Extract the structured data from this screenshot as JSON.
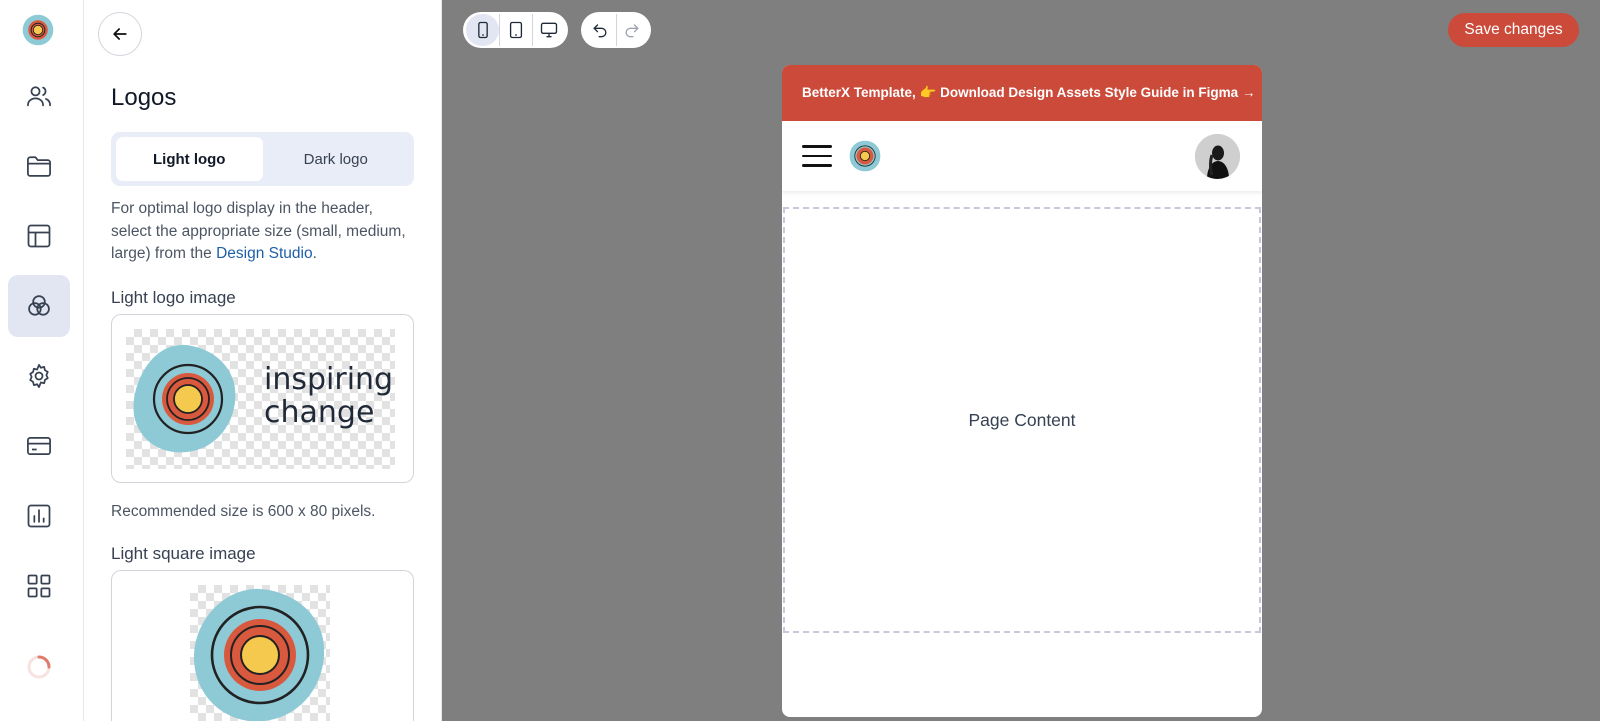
{
  "rail": {
    "items": [
      {
        "name": "users",
        "icon": "users-icon"
      },
      {
        "name": "folder",
        "icon": "folder-icon"
      },
      {
        "name": "layout",
        "icon": "layout-icon"
      },
      {
        "name": "design",
        "icon": "circles-icon",
        "active": true
      },
      {
        "name": "settings",
        "icon": "gear-icon"
      },
      {
        "name": "billing",
        "icon": "credit-card-icon"
      },
      {
        "name": "analytics",
        "icon": "bar-chart-icon"
      },
      {
        "name": "apps",
        "icon": "grid-icon"
      }
    ]
  },
  "panel": {
    "title": "Logos",
    "tabs": [
      {
        "label": "Light logo",
        "active": true
      },
      {
        "label": "Dark logo",
        "active": false
      }
    ],
    "help_text": "For optimal logo display in the header, select the appropriate size (small, medium, large) from the ",
    "help_link": "Design Studio",
    "help_end": ".",
    "light_logo_label": "Light logo image",
    "logo_word_1": "inspiring",
    "logo_word_2": "change",
    "size_hint": "Recommended size is 600 x 80 pixels.",
    "light_square_label": "Light square image"
  },
  "toolbar": {
    "devices": [
      "mobile-icon",
      "tablet-icon",
      "desktop-icon"
    ],
    "active_device": "mobile",
    "history": [
      "undo-icon",
      "redo-icon"
    ],
    "save_label": "Save changes"
  },
  "preview": {
    "announcement": "BetterX Template, 👉 Download Design Assets Style Guide in Figma →",
    "page_content": "Page Content"
  },
  "colors": {
    "accent": "#cb4a3a",
    "active_bg": "#e2e6f3",
    "link": "#1d5fa8",
    "canvas_bg": "#7f7f7f"
  }
}
